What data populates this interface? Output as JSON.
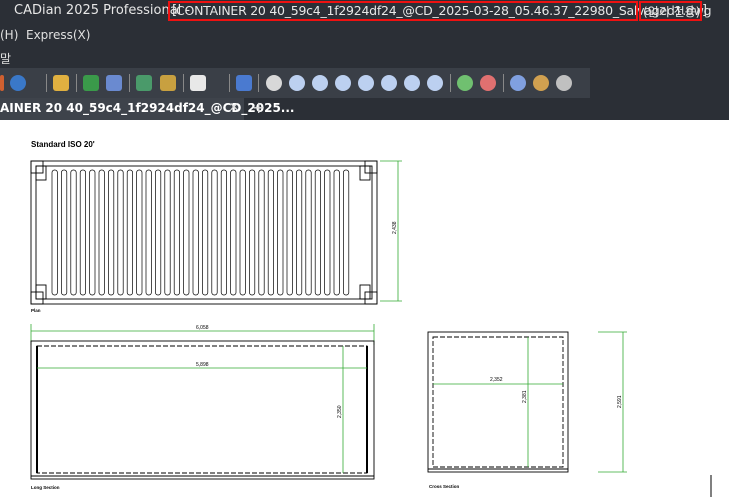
{
  "window": {
    "app_title": "CADian 2025 Professional - ",
    "open_bracket": "[",
    "file_name": "CONTAINER 20 40_59c4_1f2924df24_@CD_2025-03-28_05.46.37_22980_Salvaged1.dwg",
    "read_only": "(읽기 전용)",
    "close_bracket": "]"
  },
  "menu": {
    "help": "(H)",
    "express": "Express(X)",
    "row2_fragment": "말"
  },
  "tabs": [
    {
      "label": "AINER 20 40_59c4_1f2924df24_@CD_2025...",
      "close": "✕"
    }
  ],
  "new_tab": "+",
  "drawing": {
    "title": "Standard ISO 20'",
    "plan_label": "Plan",
    "long_section_label": "Long Section",
    "cross_section_label": "Cross Section",
    "dim_plan_height": "2,438",
    "dim_overall_length": "6,058",
    "dim_inner_length": "5,898",
    "dim_long_height": "2,350",
    "dim_cross_width": "2,352",
    "dim_cross_inner_height": "2,381",
    "dim_cross_outer_height": "2,591"
  },
  "colors": {
    "accent_red": "#e11111",
    "dim_green": "#33aa33",
    "chrome": "#2b2f36"
  }
}
